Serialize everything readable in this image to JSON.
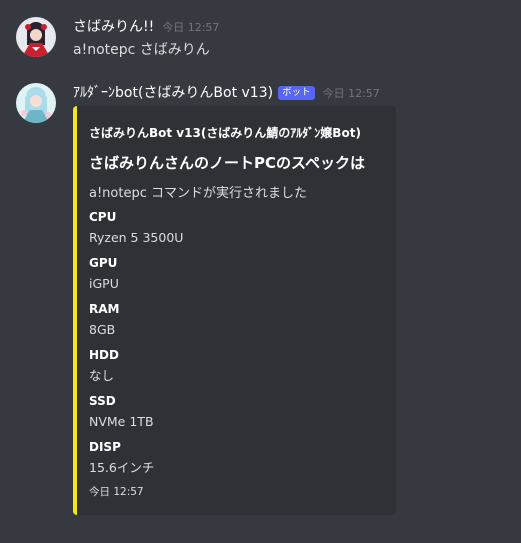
{
  "messages": [
    {
      "username": "さばみりん!!",
      "timestamp": "今日 12:57",
      "content": "a!notepc さばみりん"
    },
    {
      "username": "ｱﾙﾀﾞｰﾝbot(さばみりんBot v13)",
      "badge": "ボット",
      "timestamp": "今日 12:57",
      "embed": {
        "accent_color": "#f5e61c",
        "author": "さばみりんBot v13(さばみりん鯖のｱﾙﾀﾞﾝ嬢Bot)",
        "title": "さばみりんさんのノートPCのスペックは",
        "description": "a!notepc コマンドが実行されました",
        "fields": [
          {
            "name": "CPU",
            "value": "Ryzen 5 3500U"
          },
          {
            "name": "GPU",
            "value": "iGPU"
          },
          {
            "name": "RAM",
            "value": "8GB"
          },
          {
            "name": "HDD",
            "value": "なし"
          },
          {
            "name": "SSD",
            "value": "NVMe 1TB"
          },
          {
            "name": "DISP",
            "value": "15.6インチ"
          }
        ],
        "footer": "今日 12:57"
      }
    }
  ],
  "colors": {
    "background": "#36393f",
    "embed_background": "#2f3136",
    "bot_badge": "#5865f2",
    "timestamp": "#72767d"
  }
}
